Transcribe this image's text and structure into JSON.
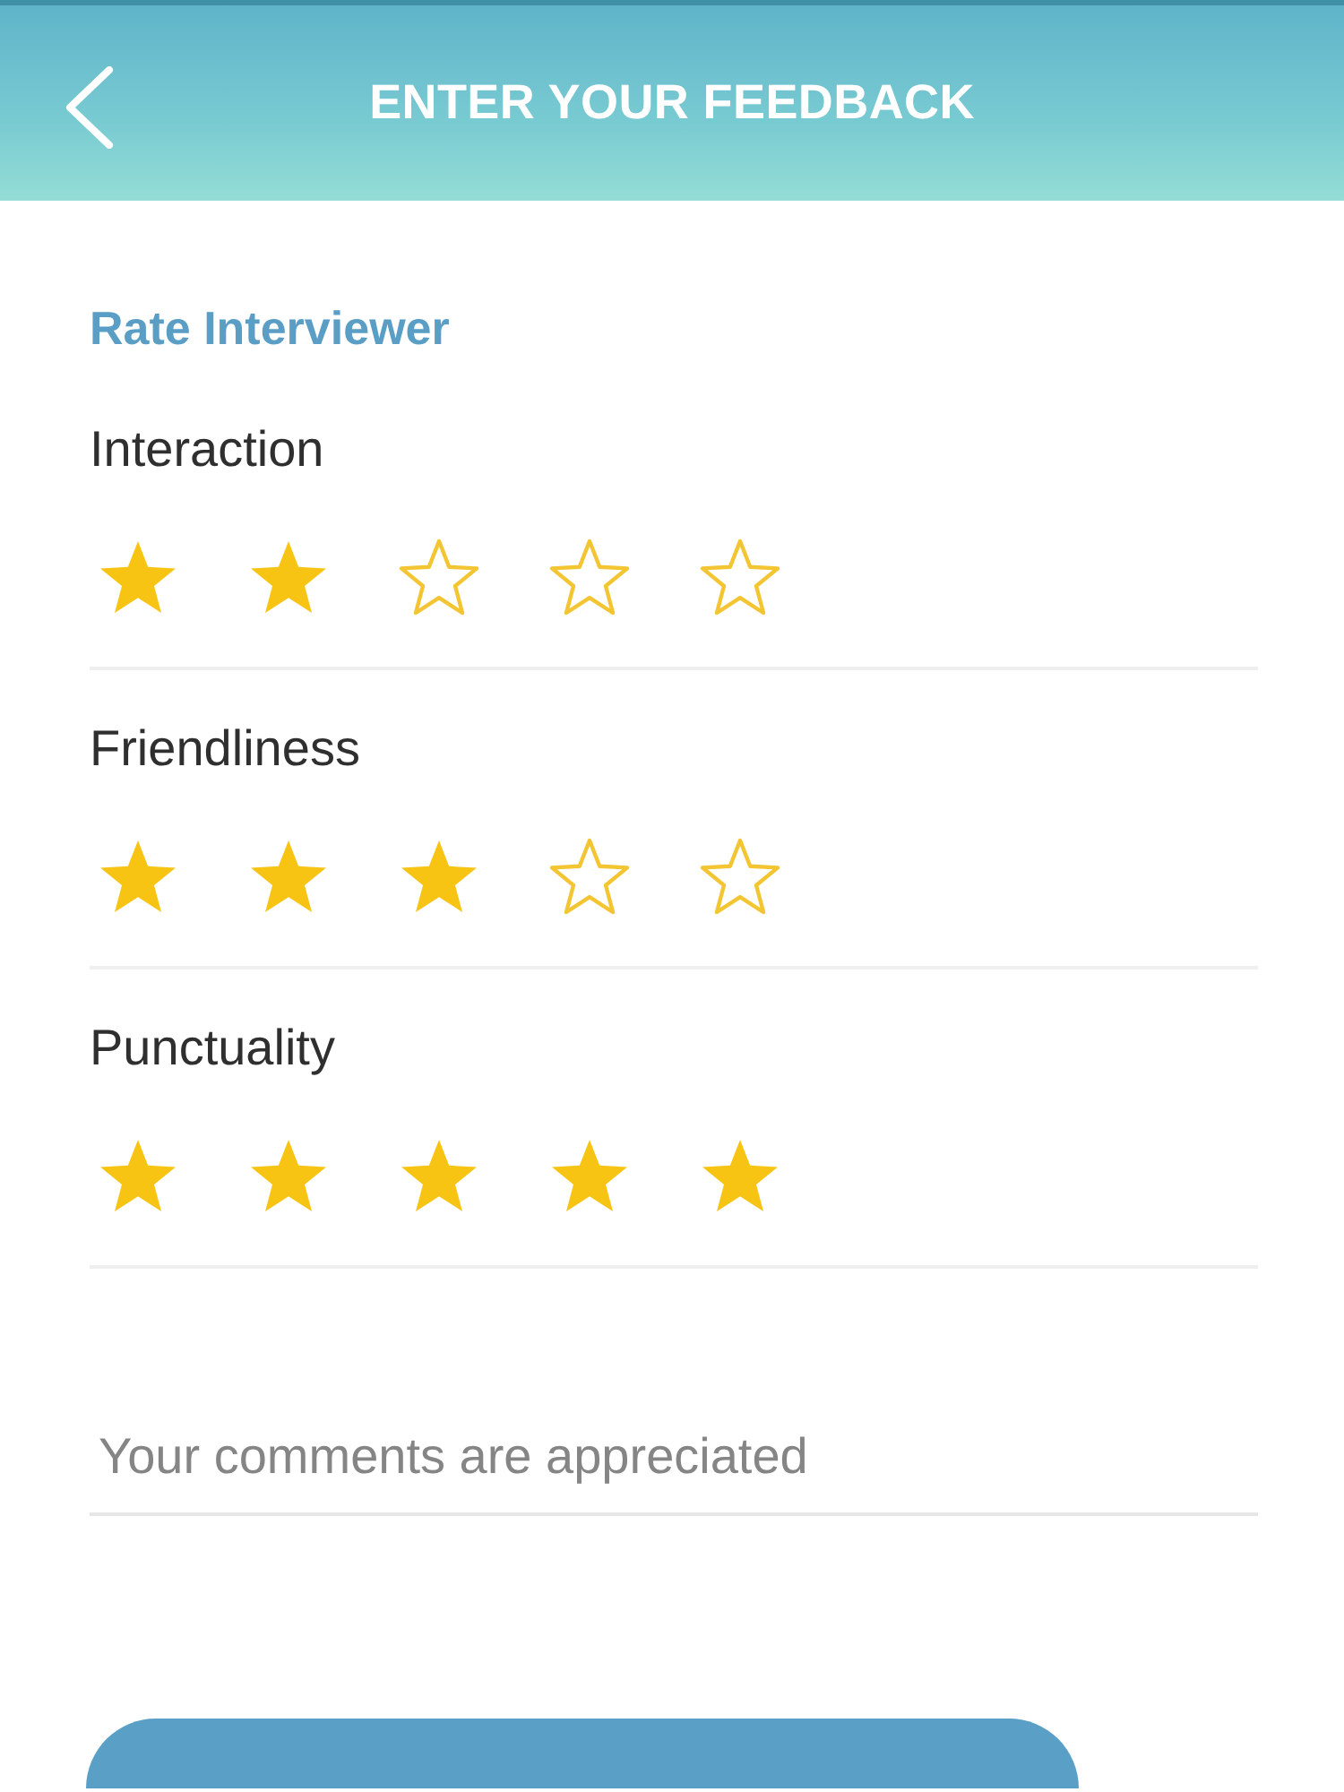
{
  "header": {
    "title": "ENTER YOUR FEEDBACK"
  },
  "section": {
    "title": "Rate Interviewer"
  },
  "ratings": [
    {
      "label": "Interaction",
      "stars": 2
    },
    {
      "label": "Friendliness",
      "stars": 3
    },
    {
      "label": "Punctuality",
      "stars": 5
    }
  ],
  "comments": {
    "placeholder": "Your comments are appreciated"
  }
}
